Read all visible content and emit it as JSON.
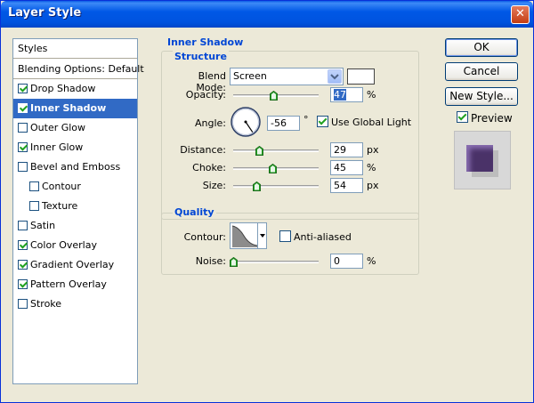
{
  "window": {
    "title": "Layer Style",
    "close_glyph": "✕"
  },
  "styles_list": {
    "header": "Styles",
    "blending": "Blending Options: Default",
    "items": [
      {
        "label": "Drop Shadow",
        "checked": true
      },
      {
        "label": "Inner Shadow",
        "checked": true,
        "selected": true
      },
      {
        "label": "Outer Glow",
        "checked": false
      },
      {
        "label": "Inner Glow",
        "checked": true
      },
      {
        "label": "Bevel and Emboss",
        "checked": false
      },
      {
        "label": "Contour",
        "checked": false,
        "indent": true
      },
      {
        "label": "Texture",
        "checked": false,
        "indent": true
      },
      {
        "label": "Satin",
        "checked": false
      },
      {
        "label": "Color Overlay",
        "checked": true
      },
      {
        "label": "Gradient Overlay",
        "checked": true
      },
      {
        "label": "Pattern Overlay",
        "checked": true
      },
      {
        "label": "Stroke",
        "checked": false
      }
    ]
  },
  "panel": {
    "title": "Inner Shadow",
    "structure": {
      "title": "Structure",
      "blend_mode_label": "Blend Mode:",
      "blend_mode_value": "Screen",
      "opacity_label": "Opacity:",
      "opacity_value": "47",
      "opacity_unit": "%",
      "opacity_fraction": 0.47,
      "angle_label": "Angle:",
      "angle_value": "-56",
      "angle_unit": "°",
      "use_global_light_label": "Use Global Light",
      "use_global_light": true,
      "distance_label": "Distance:",
      "distance_value": "29",
      "distance_unit": "px",
      "choke_label": "Choke:",
      "choke_value": "45",
      "choke_unit": "%",
      "size_label": "Size:",
      "size_value": "54",
      "size_unit": "px"
    },
    "quality": {
      "title": "Quality",
      "contour_label": "Contour:",
      "anti_aliased_label": "Anti-aliased",
      "anti_aliased": false,
      "noise_label": "Noise:",
      "noise_value": "0",
      "noise_unit": "%"
    }
  },
  "buttons": {
    "ok": "OK",
    "cancel": "Cancel",
    "new_style": "New Style...",
    "preview_label": "Preview",
    "preview_checked": true
  },
  "colors": {
    "accent": "#316ac5",
    "group_title": "#0046d5",
    "preview_shape": "#4a3268"
  }
}
